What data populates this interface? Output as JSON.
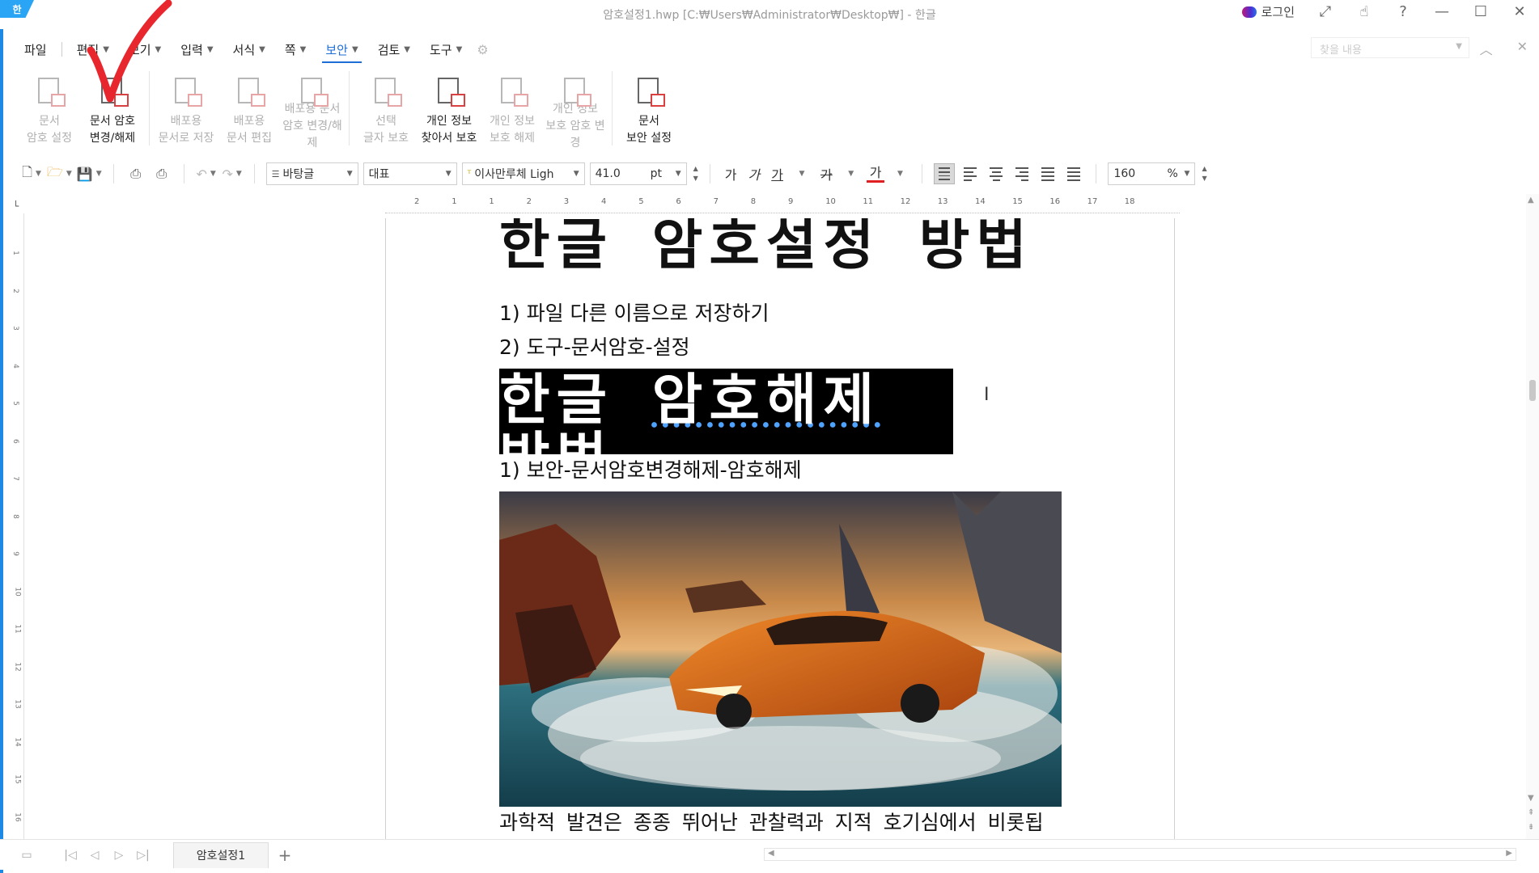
{
  "app": {
    "logo": "한",
    "window_title": "암호설정1.hwp [C:₩Users₩Administrator₩Desktop₩] - 한글",
    "login_label": "로그인"
  },
  "menu": {
    "items": [
      {
        "label": "파일",
        "chevron": false
      },
      {
        "label": "편집",
        "chevron": true
      },
      {
        "label": "보기",
        "chevron": true
      },
      {
        "label": "입력",
        "chevron": true
      },
      {
        "label": "서식",
        "chevron": true
      },
      {
        "label": "쪽",
        "chevron": true
      },
      {
        "label": "보안",
        "chevron": true,
        "active": true
      },
      {
        "label": "검토",
        "chevron": true
      },
      {
        "label": "도구",
        "chevron": true
      }
    ],
    "search_placeholder": "찾을 내용"
  },
  "ribbon": {
    "groups": [
      [
        {
          "line1": "문서",
          "line2": "암호 설정",
          "disabled": true
        },
        {
          "line1": "문서 암호",
          "line2": "변경/해제",
          "disabled": false
        }
      ],
      [
        {
          "line1": "배포용",
          "line2": "문서로 저장",
          "disabled": true
        },
        {
          "line1": "배포용",
          "line2": "문서 편집",
          "disabled": true
        },
        {
          "line1": "배포용 문서",
          "line2": "암호 변경/해제",
          "disabled": true
        }
      ],
      [
        {
          "line1": "선택",
          "line2": "글자 보호",
          "disabled": true
        },
        {
          "line1": "개인 정보",
          "line2": "찾아서 보호",
          "disabled": false
        },
        {
          "line1": "개인 정보",
          "line2": "보호 해제",
          "disabled": true
        },
        {
          "line1": "개인 정보",
          "line2": "보호 암호 변경",
          "disabled": true
        }
      ],
      [
        {
          "line1": "문서",
          "line2": "보안 설정",
          "disabled": false
        }
      ]
    ]
  },
  "toolbar": {
    "style_value": "바탕글",
    "lang_value": "대표",
    "font_value": "이사만루체 Ligh",
    "size_value": "41.0",
    "size_unit": "pt",
    "char_buttons": [
      "가",
      "가",
      "가",
      "가",
      "가"
    ],
    "zoom_value": "160",
    "zoom_unit": "%"
  },
  "ruler": {
    "h_numbers": [
      "2",
      "1",
      "1",
      "2",
      "3",
      "4",
      "5",
      "6",
      "7",
      "8",
      "9",
      "10",
      "11",
      "12",
      "13",
      "14",
      "15",
      "16",
      "17",
      "18"
    ],
    "v_numbers": [
      "1",
      "2",
      "3",
      "4",
      "5",
      "6",
      "7",
      "8",
      "9",
      "10",
      "11",
      "12",
      "13",
      "14",
      "15",
      "16"
    ]
  },
  "document": {
    "heading1": "한글 암호설정 방법",
    "step1": "1) 파일 다른 이름으로 저장하기",
    "step2": "2) 도구-문서암호-설정",
    "heading2_part1": "한글 ",
    "heading2_part2": "암호해제",
    "heading2_part3": " 방법",
    "step3": "1) 보안-문서암호변경해제-암호해제",
    "caption": "과학적 발견은 종종 뛰어난 관찰력과 지적 호기심에서 비롯됩"
  },
  "tabs": {
    "doc_tab": "암호설정1"
  },
  "colors": {
    "accent": "#1e6ed8",
    "checkmark": "#e8262d",
    "selection": "#000000"
  }
}
